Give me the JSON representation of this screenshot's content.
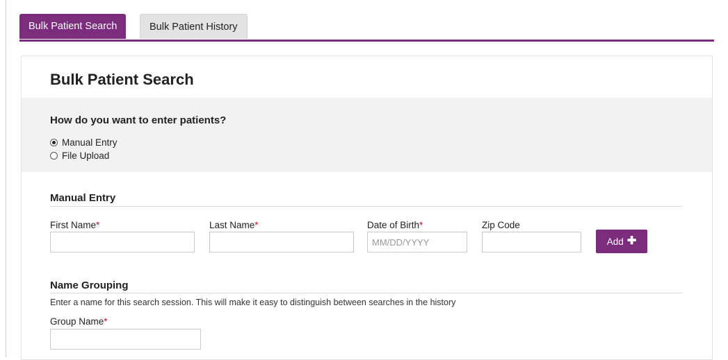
{
  "tabs": [
    {
      "label": "Bulk Patient Search",
      "active": true
    },
    {
      "label": "Bulk Patient History",
      "active": false
    }
  ],
  "page": {
    "title": "Bulk Patient Search"
  },
  "entry_method": {
    "question": "How do you want to enter patients?",
    "options": [
      {
        "label": "Manual Entry",
        "selected": true
      },
      {
        "label": "File Upload",
        "selected": false
      }
    ]
  },
  "manual_entry": {
    "section_title": "Manual Entry",
    "first_name": {
      "label": "First Name",
      "required_mark": "*",
      "value": "",
      "placeholder": ""
    },
    "last_name": {
      "label": "Last Name",
      "required_mark": "*",
      "value": "",
      "placeholder": ""
    },
    "dob": {
      "label": "Date of Birth",
      "required_mark": "*",
      "value": "",
      "placeholder": "MM/DD/YYYY"
    },
    "zip": {
      "label": "Zip Code",
      "value": "",
      "placeholder": ""
    },
    "add_button": {
      "label": "Add",
      "icon": "plus-icon"
    }
  },
  "name_grouping": {
    "section_title": "Name Grouping",
    "help_text": "Enter a name for this search session. This will make it easy to distinguish between searches in the history",
    "group_name": {
      "label": "Group Name",
      "required_mark": "*",
      "value": "",
      "placeholder": ""
    }
  },
  "colors": {
    "accent": "#7b2c7d",
    "required": "#c8102e",
    "panel_grey": "#f2f2f2"
  }
}
